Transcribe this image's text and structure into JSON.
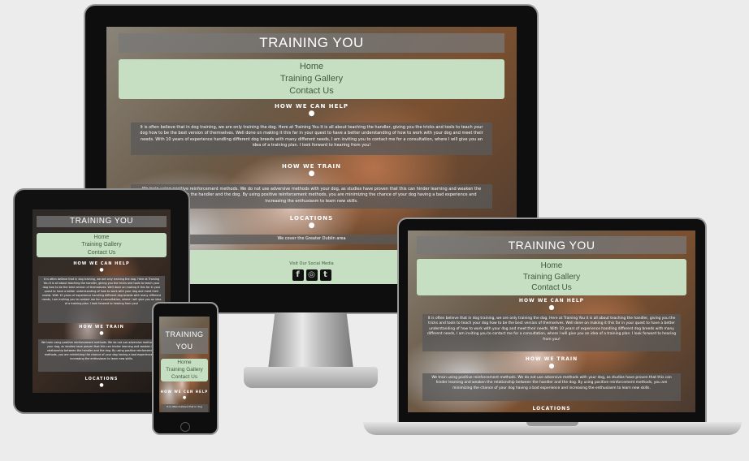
{
  "site": {
    "title": "TRAINING YOU",
    "title_line1": "TRAINING",
    "title_line2": "YOU",
    "nav": [
      "Home",
      "Training Gallery",
      "Contact Us"
    ],
    "section1": {
      "heading": "HOW WE CAN HELP",
      "icon": "paw-icon",
      "text": "It is often believe that in dog training, we are only training the dog. Here at Training You it is all about teaching the handler, giving you the tricks and tools to teach your dog how to be the best version of themselves. Well done on making it this far in your quest to have a better understanding of how to work with your dog and meet their needs. With 10 years of experience handling different dog breeds with many different needs, I am inviting you to contact me for a consultation, where I will give you an idea of a training plan. I look forward to hearing from you!"
    },
    "section2": {
      "heading": "HOW WE TRAIN",
      "icon": "paw-icon",
      "text": "We train using positive reinforcement methods. We do not use adversive methods with your dog, as studies have proven that this can hinder learning and weaken the relationship between the handler and the dog. By using positive reinforcement methods, you are minimizing the chance of your dog having a bad experience and increasing the enthusiasm to learn new skills."
    },
    "section3": {
      "heading": "LOCATIONS",
      "icon": "paw-icon",
      "text": "We cover the Greater Dublin area"
    },
    "footer": {
      "text": "Visit Our Social Media",
      "icons": [
        "facebook-icon",
        "instagram-icon",
        "twitter-icon"
      ]
    },
    "mobile_snippet": "It is often believe that in dog"
  },
  "colors": {
    "nav_bg": "#c6dfc3",
    "title_bg": "#787878",
    "background": "#ececec"
  }
}
